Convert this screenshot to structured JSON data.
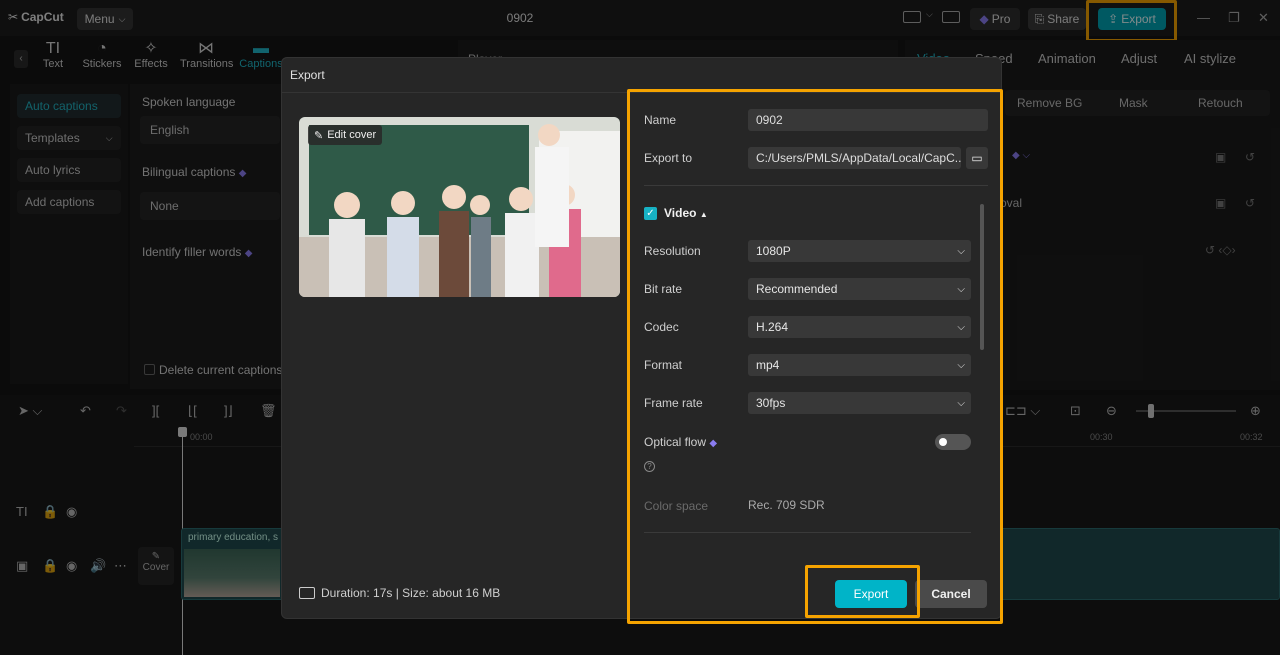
{
  "app": {
    "logo": "CapCut",
    "menu_label": "Menu",
    "project_title": "0902",
    "pro_label": "Pro",
    "share_label": "Share",
    "export_label": "Export"
  },
  "toolbar": {
    "tabs": [
      {
        "label": "Text",
        "icon": "text-icon"
      },
      {
        "label": "Stickers",
        "icon": "sticker-icon"
      },
      {
        "label": "Effects",
        "icon": "effects-icon"
      },
      {
        "label": "Transitions",
        "icon": "transitions-icon"
      },
      {
        "label": "Captions",
        "icon": "captions-icon"
      }
    ]
  },
  "left_nav": {
    "items": [
      "Auto captions",
      "Templates",
      "Auto lyrics",
      "Add captions"
    ]
  },
  "captions_panel": {
    "spoken_language_label": "Spoken language",
    "spoken_language_value": "English",
    "bilingual_label": "Bilingual captions",
    "bilingual_value": "None",
    "filler_label": "Identify filler words",
    "delete_label": "Delete current captions"
  },
  "player": {
    "label": "Player"
  },
  "right_panel": {
    "tabs": [
      "Video",
      "Speed",
      "Animation",
      "Adjust",
      "AI stylize"
    ],
    "subtabs": [
      "Remove BG",
      "Mask",
      "Retouch"
    ],
    "row_labels": [
      "oval"
    ]
  },
  "timeline": {
    "time_start": "00:00",
    "time_mark1": "00:30",
    "time_mark2": "00:32",
    "clip_label": "primary education, s",
    "cover_label": "Cover"
  },
  "dialog": {
    "title": "Export",
    "edit_cover_label": "Edit cover",
    "name_label": "Name",
    "name_value": "0902",
    "export_to_label": "Export to",
    "export_to_value": "C:/Users/PMLS/AppData/Local/CapC...",
    "video_section": "Video",
    "resolution_label": "Resolution",
    "resolution_value": "1080P",
    "bitrate_label": "Bit rate",
    "bitrate_value": "Recommended",
    "codec_label": "Codec",
    "codec_value": "H.264",
    "format_label": "Format",
    "format_value": "mp4",
    "framerate_label": "Frame rate",
    "framerate_value": "30fps",
    "optical_flow_label": "Optical flow",
    "color_space_label": "Color space",
    "color_space_value": "Rec. 709 SDR",
    "duration_text": "Duration: 17s | Size: about 16 MB",
    "export_button": "Export",
    "cancel_button": "Cancel"
  },
  "colors": {
    "accent": "#00b4c8",
    "highlight": "#f5a300",
    "dialog_bg": "#262626"
  }
}
